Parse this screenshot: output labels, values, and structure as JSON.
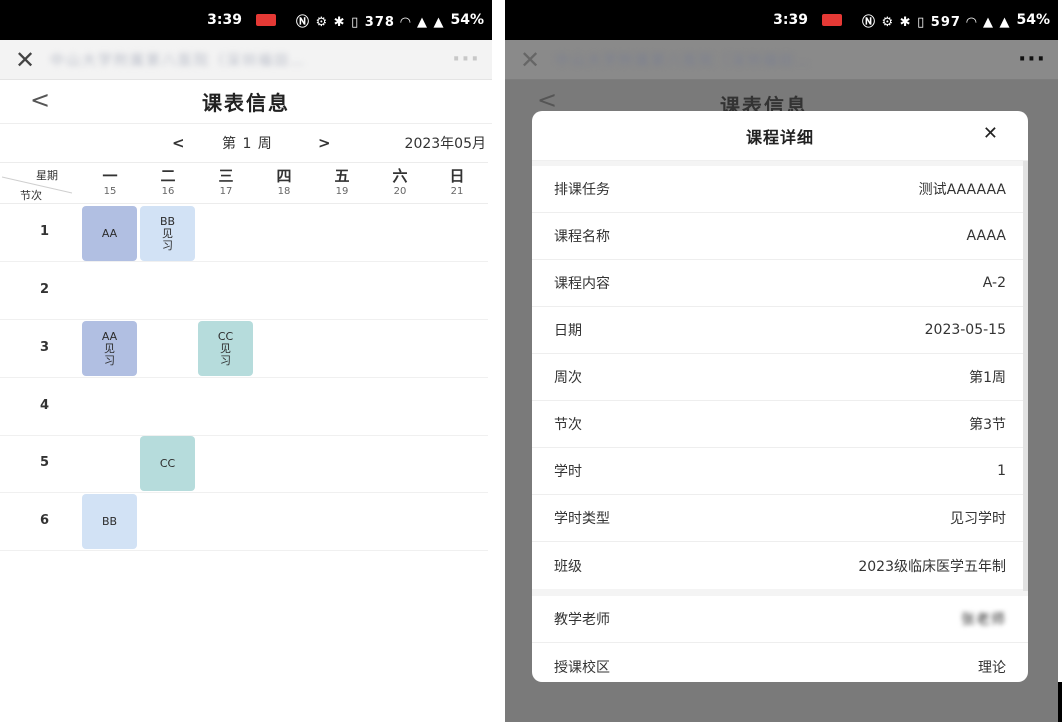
{
  "left": {
    "status": {
      "time": "3:39",
      "icons": "Ⓝ ⚙ ✱ ▯ 378 ◠ ▲ ▲",
      "battery": "54%"
    },
    "nav": {
      "close": "✕",
      "title": "中山大学附属第八医院（深圳福田…",
      "more": "···"
    },
    "header": {
      "back": "<",
      "title": "课表信息"
    },
    "week": {
      "prev": "<",
      "label": "第 1 周",
      "next": ">",
      "month": "2023年05月"
    },
    "corner": {
      "week_label": "星期",
      "period_label": "节次"
    },
    "days": [
      {
        "name": "一",
        "date": "15"
      },
      {
        "name": "二",
        "date": "16"
      },
      {
        "name": "三",
        "date": "17"
      },
      {
        "name": "四",
        "date": "18"
      },
      {
        "name": "五",
        "date": "19"
      },
      {
        "name": "六",
        "date": "20"
      },
      {
        "name": "日",
        "date": "21"
      }
    ],
    "periods": [
      "1",
      "2",
      "3",
      "4",
      "5",
      "6"
    ],
    "courses": [
      {
        "id": "aa-1",
        "line1": "AA",
        "line2": "",
        "line3": ""
      },
      {
        "id": "bb-1",
        "line1": "BB",
        "line2": "见",
        "line3": "习"
      },
      {
        "id": "aa-3",
        "line1": "AA",
        "line2": "见",
        "line3": "习"
      },
      {
        "id": "cc-3",
        "line1": "CC",
        "line2": "见",
        "line3": "习"
      },
      {
        "id": "cc-5",
        "line1": "CC",
        "line2": "",
        "line3": ""
      },
      {
        "id": "bb-6",
        "line1": "BB",
        "line2": "",
        "line3": ""
      }
    ]
  },
  "right": {
    "status": {
      "time": "3:39",
      "icons": "Ⓝ ⚙ ✱ ▯ 597 ◠ ▲ ▲",
      "battery": "54%"
    },
    "nav": {
      "close": "✕",
      "title": "中山大学附属第八医院（深圳福田…",
      "more": "···"
    },
    "ghost": {
      "back": "<",
      "title": "课表信息"
    },
    "modal": {
      "title": "课程详细",
      "close": "✕",
      "rows": [
        {
          "label": "排课任务",
          "value": "测试AAAAAA"
        },
        {
          "label": "课程名称",
          "value": "AAAA"
        },
        {
          "label": "课程内容",
          "value": "A-2"
        },
        {
          "label": "日期",
          "value": "2023-05-15"
        },
        {
          "label": "周次",
          "value": "第1周"
        },
        {
          "label": "节次",
          "value": "第3节"
        },
        {
          "label": "学时",
          "value": "1"
        },
        {
          "label": "学时类型",
          "value": "见习学时"
        },
        {
          "label": "班级",
          "value": "2023级临床医学五年制"
        }
      ],
      "teacher": {
        "label": "教学老师",
        "value": "张老师"
      },
      "campus": {
        "label": "授课校区",
        "value": "理论"
      }
    }
  }
}
